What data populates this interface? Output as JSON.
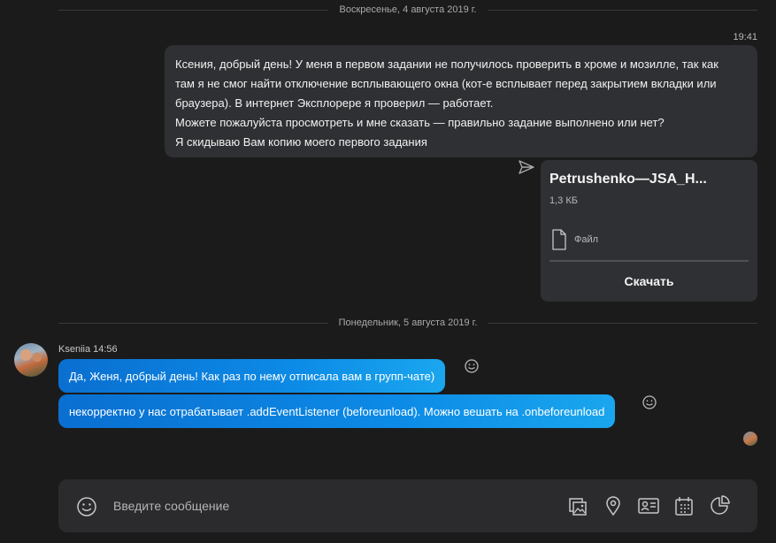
{
  "dividers": {
    "first": "Воскресенье, 4 августа 2019 г.",
    "second": "Понедельник, 5 августа 2019 г."
  },
  "outgoing": {
    "time": "19:41",
    "lines": [
      "Ксения, добрый день! У меня в первом задании не получилось проверить в хроме и мозилле, так как",
      "там я не смог найти отключение всплывающего окна (кот-е всплывает перед закрытием вкладки или",
      "браузера). В интернет Эксплорере я проверил — работает.",
      "Можете пожалуйста просмотреть и мне сказать — правильно задание выполнено или нет?",
      "Я скидываю Вам копию моего первого задания"
    ],
    "file": {
      "name": "Petrushenko—JSA_H...",
      "size": "1,3 КБ",
      "type_label": "Файл",
      "download_label": "Скачать"
    }
  },
  "incoming": {
    "sender": "Kseniia",
    "time": "14:56",
    "messages": [
      "Да, Женя, добрый день! Как раз по нему отписала вам в групп-чате)",
      "некорректно у нас отрабатывает .addEventListener (beforeunload). Можно вешать на .onbeforeunload"
    ]
  },
  "composer": {
    "placeholder": "Введите сообщение"
  },
  "icons": {
    "send": "send-icon",
    "file": "file-icon",
    "emoji": "smiley-icon",
    "gallery": "gallery-icon",
    "location": "location-icon",
    "contact": "contact-card-icon",
    "call": "call-icon",
    "poll": "poll-icon"
  },
  "colors": {
    "background": "#1b1b1c",
    "outgoing_bubble": "#2f3033",
    "incoming_bubble_start": "#0a6fd0",
    "incoming_bubble_end": "#1aa6ee"
  }
}
